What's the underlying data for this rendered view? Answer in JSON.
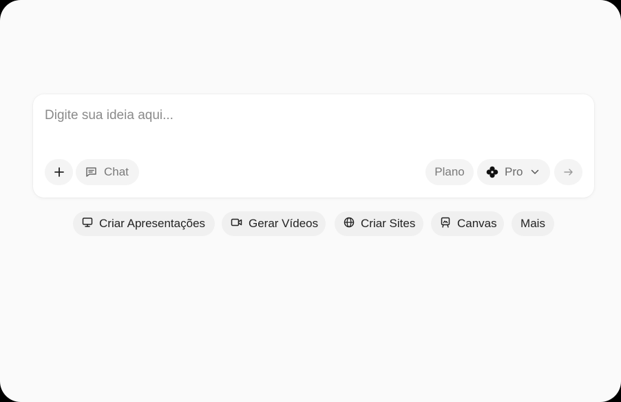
{
  "composer": {
    "placeholder": "Digite sua ideia aqui...",
    "mode_label": "Chat",
    "plan_label": "Plano",
    "model_label": "Pro"
  },
  "suggestions": {
    "presentations": "Criar Apresentações",
    "videos": "Gerar Vídeos",
    "sites": "Criar Sites",
    "canvas": "Canvas",
    "more": "Mais"
  },
  "icons": {
    "add": "plus-icon",
    "chat": "chat-bubble-icon",
    "model": "flower-logo-icon",
    "dropdown": "chevron-down-icon",
    "send": "arrow-right-icon",
    "presentations": "monitor-icon",
    "videos": "video-camera-icon",
    "sites": "globe-icon",
    "canvas": "easel-icon"
  }
}
